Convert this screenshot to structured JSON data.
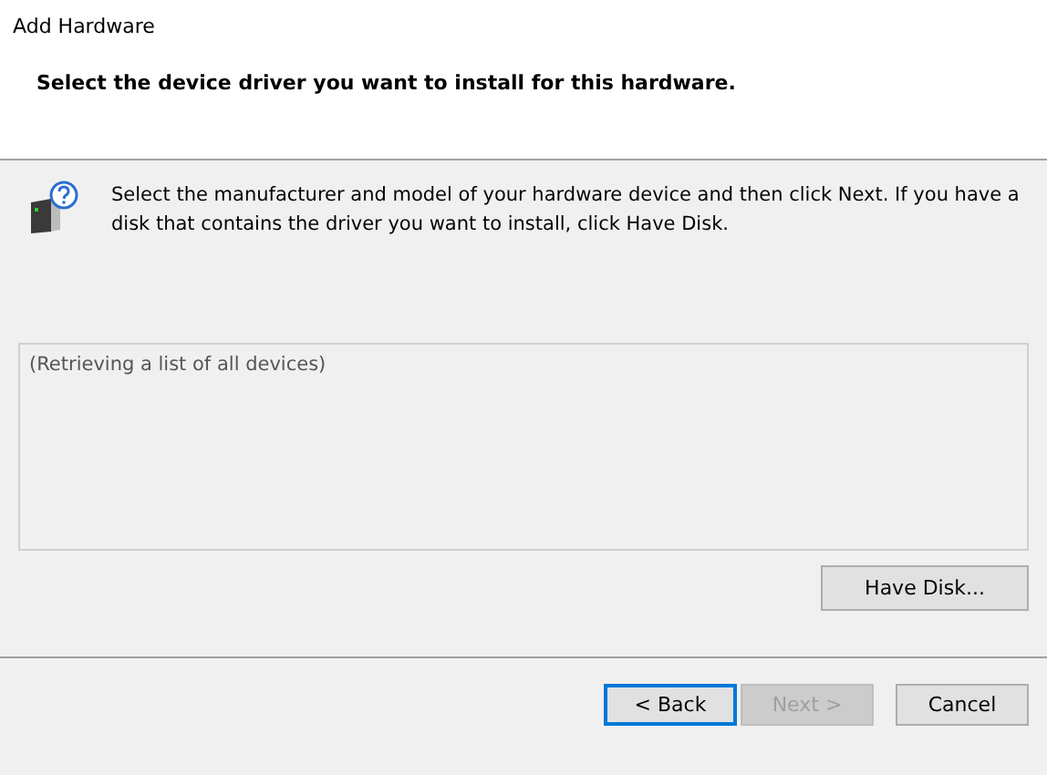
{
  "window": {
    "title": "Add Hardware"
  },
  "header": {
    "heading": "Select the device driver you want to install for this hardware."
  },
  "instructions": "Select the manufacturer and model of your hardware device and then click Next. If you have a disk that contains the driver you want to install, click Have Disk.",
  "device_list": {
    "status": "(Retrieving a list of all devices)"
  },
  "have_disk_button": {
    "label": "Have Disk..."
  },
  "buttons": [
    {
      "label": "< Back",
      "default": true,
      "disabled": false
    },
    {
      "label": "Next >",
      "default": false,
      "disabled": true
    },
    {
      "label": "Cancel",
      "default": false,
      "disabled": false
    }
  ]
}
